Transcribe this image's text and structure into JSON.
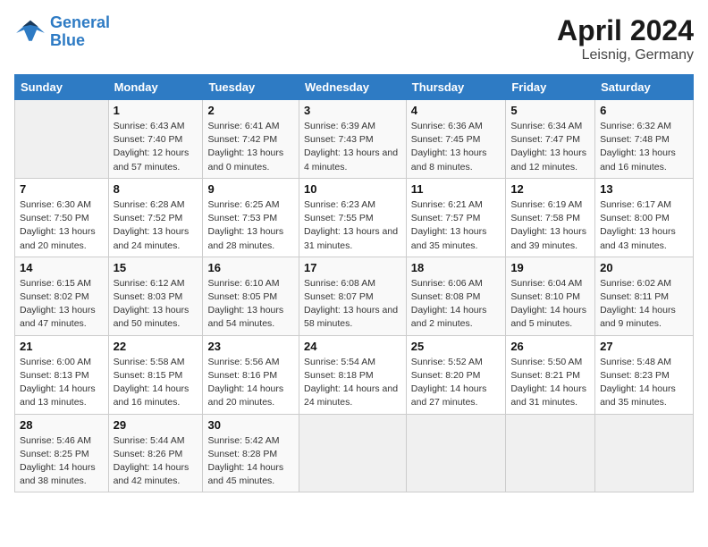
{
  "logo": {
    "line1": "General",
    "line2": "Blue"
  },
  "title": "April 2024",
  "subtitle": "Leisnig, Germany",
  "weekdays": [
    "Sunday",
    "Monday",
    "Tuesday",
    "Wednesday",
    "Thursday",
    "Friday",
    "Saturday"
  ],
  "weeks": [
    [
      {
        "day": "",
        "empty": true
      },
      {
        "day": "1",
        "sunrise": "6:43 AM",
        "sunset": "7:40 PM",
        "daylight": "12 hours and 57 minutes."
      },
      {
        "day": "2",
        "sunrise": "6:41 AM",
        "sunset": "7:42 PM",
        "daylight": "13 hours and 0 minutes."
      },
      {
        "day": "3",
        "sunrise": "6:39 AM",
        "sunset": "7:43 PM",
        "daylight": "13 hours and 4 minutes."
      },
      {
        "day": "4",
        "sunrise": "6:36 AM",
        "sunset": "7:45 PM",
        "daylight": "13 hours and 8 minutes."
      },
      {
        "day": "5",
        "sunrise": "6:34 AM",
        "sunset": "7:47 PM",
        "daylight": "13 hours and 12 minutes."
      },
      {
        "day": "6",
        "sunrise": "6:32 AM",
        "sunset": "7:48 PM",
        "daylight": "13 hours and 16 minutes."
      }
    ],
    [
      {
        "day": "7",
        "sunrise": "6:30 AM",
        "sunset": "7:50 PM",
        "daylight": "13 hours and 20 minutes."
      },
      {
        "day": "8",
        "sunrise": "6:28 AM",
        "sunset": "7:52 PM",
        "daylight": "13 hours and 24 minutes."
      },
      {
        "day": "9",
        "sunrise": "6:25 AM",
        "sunset": "7:53 PM",
        "daylight": "13 hours and 28 minutes."
      },
      {
        "day": "10",
        "sunrise": "6:23 AM",
        "sunset": "7:55 PM",
        "daylight": "13 hours and 31 minutes."
      },
      {
        "day": "11",
        "sunrise": "6:21 AM",
        "sunset": "7:57 PM",
        "daylight": "13 hours and 35 minutes."
      },
      {
        "day": "12",
        "sunrise": "6:19 AM",
        "sunset": "7:58 PM",
        "daylight": "13 hours and 39 minutes."
      },
      {
        "day": "13",
        "sunrise": "6:17 AM",
        "sunset": "8:00 PM",
        "daylight": "13 hours and 43 minutes."
      }
    ],
    [
      {
        "day": "14",
        "sunrise": "6:15 AM",
        "sunset": "8:02 PM",
        "daylight": "13 hours and 47 minutes."
      },
      {
        "day": "15",
        "sunrise": "6:12 AM",
        "sunset": "8:03 PM",
        "daylight": "13 hours and 50 minutes."
      },
      {
        "day": "16",
        "sunrise": "6:10 AM",
        "sunset": "8:05 PM",
        "daylight": "13 hours and 54 minutes."
      },
      {
        "day": "17",
        "sunrise": "6:08 AM",
        "sunset": "8:07 PM",
        "daylight": "13 hours and 58 minutes."
      },
      {
        "day": "18",
        "sunrise": "6:06 AM",
        "sunset": "8:08 PM",
        "daylight": "14 hours and 2 minutes."
      },
      {
        "day": "19",
        "sunrise": "6:04 AM",
        "sunset": "8:10 PM",
        "daylight": "14 hours and 5 minutes."
      },
      {
        "day": "20",
        "sunrise": "6:02 AM",
        "sunset": "8:11 PM",
        "daylight": "14 hours and 9 minutes."
      }
    ],
    [
      {
        "day": "21",
        "sunrise": "6:00 AM",
        "sunset": "8:13 PM",
        "daylight": "14 hours and 13 minutes."
      },
      {
        "day": "22",
        "sunrise": "5:58 AM",
        "sunset": "8:15 PM",
        "daylight": "14 hours and 16 minutes."
      },
      {
        "day": "23",
        "sunrise": "5:56 AM",
        "sunset": "8:16 PM",
        "daylight": "14 hours and 20 minutes."
      },
      {
        "day": "24",
        "sunrise": "5:54 AM",
        "sunset": "8:18 PM",
        "daylight": "14 hours and 24 minutes."
      },
      {
        "day": "25",
        "sunrise": "5:52 AM",
        "sunset": "8:20 PM",
        "daylight": "14 hours and 27 minutes."
      },
      {
        "day": "26",
        "sunrise": "5:50 AM",
        "sunset": "8:21 PM",
        "daylight": "14 hours and 31 minutes."
      },
      {
        "day": "27",
        "sunrise": "5:48 AM",
        "sunset": "8:23 PM",
        "daylight": "14 hours and 35 minutes."
      }
    ],
    [
      {
        "day": "28",
        "sunrise": "5:46 AM",
        "sunset": "8:25 PM",
        "daylight": "14 hours and 38 minutes."
      },
      {
        "day": "29",
        "sunrise": "5:44 AM",
        "sunset": "8:26 PM",
        "daylight": "14 hours and 42 minutes."
      },
      {
        "day": "30",
        "sunrise": "5:42 AM",
        "sunset": "8:28 PM",
        "daylight": "14 hours and 45 minutes."
      },
      {
        "day": "",
        "empty": true
      },
      {
        "day": "",
        "empty": true
      },
      {
        "day": "",
        "empty": true
      },
      {
        "day": "",
        "empty": true
      }
    ]
  ]
}
